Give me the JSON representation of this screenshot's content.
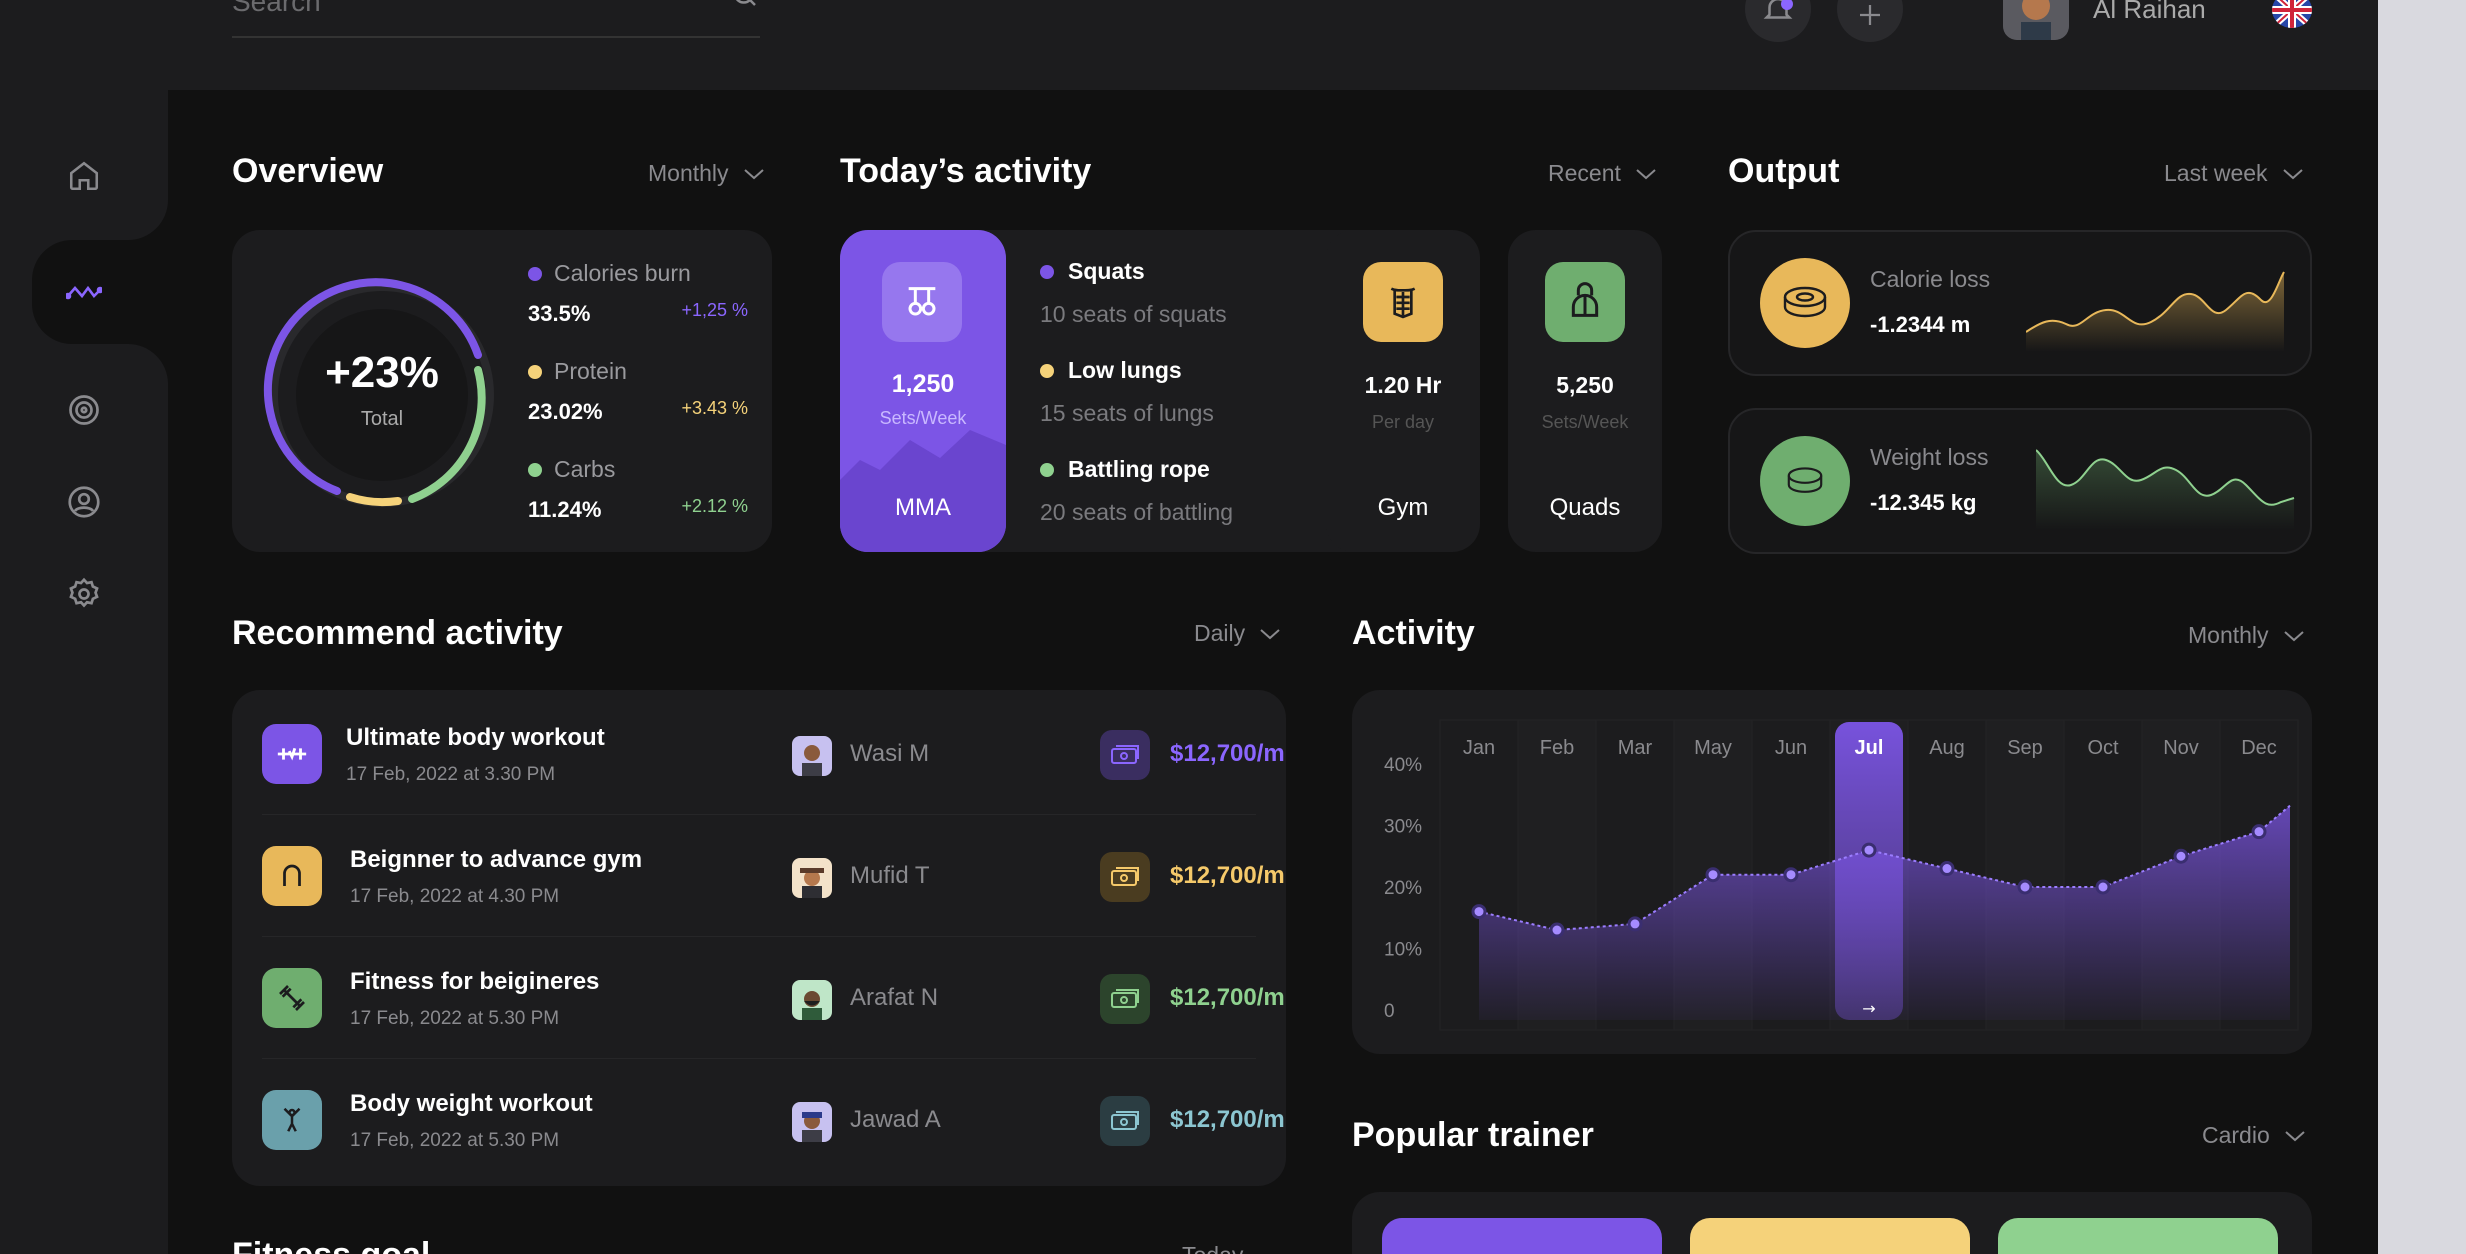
{
  "header": {
    "search_placeholder": "Search",
    "user_name": "Al Raihan"
  },
  "sidebar": {
    "items": [
      "home",
      "activity",
      "target",
      "profile",
      "settings"
    ]
  },
  "overview": {
    "title": "Overview",
    "filter": "Monthly",
    "total_value": "+23%",
    "total_label": "Total",
    "items": [
      {
        "name": "Calories burn",
        "value": "33.5%",
        "delta": "+1,25 %",
        "color": "#7c55e6"
      },
      {
        "name": "Protein",
        "value": "23.02%",
        "delta": "+3.43 %",
        "color": "#f5d27a"
      },
      {
        "name": "Carbs",
        "value": "11.24%",
        "delta": "+2.12 %",
        "color": "#8fd18f"
      }
    ]
  },
  "today": {
    "title": "Today’s activity",
    "filter": "Recent",
    "featured": {
      "value": "1,250",
      "unit": "Sets/Week",
      "label": "MMA"
    },
    "list": [
      {
        "name": "Squats",
        "detail": "10 seats of squats",
        "color": "#7c55e6"
      },
      {
        "name": "Low lungs",
        "detail": "15 seats of lungs",
        "color": "#f5d27a"
      },
      {
        "name": "Battling rope",
        "detail": "20 seats of battling",
        "color": "#8fd18f"
      }
    ],
    "stats": [
      {
        "value": "1.20 Hr",
        "unit": "Per day",
        "label": "Gym",
        "color": "#e8b85a"
      },
      {
        "value": "5,250",
        "unit": "Sets/Week",
        "label": "Quads",
        "color": "#6fae6f"
      }
    ]
  },
  "output": {
    "title": "Output",
    "filter": "Last week",
    "items": [
      {
        "label": "Calorie loss",
        "value": "-1.2344 m",
        "color": "#e8b85a"
      },
      {
        "label": "Weight loss",
        "value": "-12.345 kg",
        "color": "#6fae6f"
      }
    ]
  },
  "recommend": {
    "title": "Recommend activity",
    "filter": "Daily",
    "rows": [
      {
        "title": "Ultimate body workout",
        "date": "17 Feb, 2022 at 3.30 PM",
        "trainer": "Wasi M",
        "price": "$12,700/m",
        "color": "#7c55e6",
        "price_color": "#8b66ff"
      },
      {
        "title": "Beignner to advance gym",
        "date": "17 Feb, 2022 at 4.30 PM",
        "trainer": "Mufid T",
        "price": "$12,700/m",
        "color": "#e8b85a",
        "price_color": "#f5c96a"
      },
      {
        "title": "Fitness for beigineres",
        "date": "17 Feb, 2022 at 5.30 PM",
        "trainer": "Arafat N",
        "price": "$12,700/m",
        "color": "#6fae6f",
        "price_color": "#8fd18f"
      },
      {
        "title": "Body weight workout",
        "date": "17 Feb, 2022 at 5.30 PM",
        "trainer": "Jawad A",
        "price": "$12,700/m",
        "color": "#6aa0ab",
        "price_color": "#8cc6d1"
      }
    ]
  },
  "activity": {
    "title": "Activity",
    "filter": "Monthly",
    "active_month": "Jul",
    "active_marker": "→"
  },
  "chart_data": {
    "type": "area",
    "categories": [
      "Jan",
      "Feb",
      "Mar",
      "May",
      "Jun",
      "Jul",
      "Aug",
      "Sep",
      "Oct",
      "Nov",
      "Dec"
    ],
    "series": [
      {
        "values": [
          16,
          13,
          14,
          22,
          22,
          26,
          23,
          20,
          20,
          25,
          29
        ]
      }
    ],
    "yticks": [
      "40%",
      "30%",
      "20%",
      "10%",
      "0"
    ],
    "ylim": [
      0,
      40
    ],
    "grid": true
  },
  "popular": {
    "title": "Popular trainer",
    "filter": "Cardio"
  },
  "fitness_goal": {
    "title": "Fitness goal",
    "filter": "Today"
  }
}
